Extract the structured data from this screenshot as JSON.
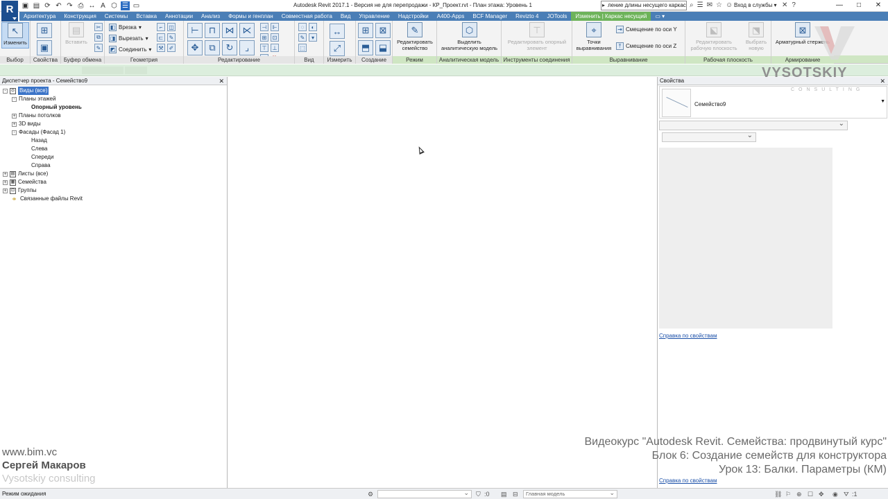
{
  "app": {
    "logo_letter": "R",
    "window_title": "Autodesk Revit 2017.1 - Версия не для перепродажи -   КР_Проект.rvt - План этажа: Уровень 1",
    "search_text": "ление длины несущего каркаса",
    "login_label": "Вход в службы",
    "qat_icons": [
      "open-icon",
      "save-icon",
      "sync-icon",
      "undo-icon",
      "redo-icon",
      "print-icon",
      "measure-icon",
      "text-icon",
      "3d-view-icon",
      "close-windows-icon",
      "switch-windows-icon"
    ],
    "window_controls": [
      "minimize",
      "maximize",
      "close"
    ]
  },
  "tabs": [
    {
      "label": "Архитектура"
    },
    {
      "label": "Конструкция"
    },
    {
      "label": "Системы"
    },
    {
      "label": "Вставка"
    },
    {
      "label": "Аннотации"
    },
    {
      "label": "Анализ"
    },
    {
      "label": "Формы и генплан"
    },
    {
      "label": "Совместная работа"
    },
    {
      "label": "Вид"
    },
    {
      "label": "Управление"
    },
    {
      "label": "Надстройки"
    },
    {
      "label": "A400-Apps"
    },
    {
      "label": "BCF Manager"
    },
    {
      "label": "Revizto 4"
    },
    {
      "label": "JOTools"
    },
    {
      "label": "Изменить | Каркас несущий",
      "active": true
    }
  ],
  "ribbon": {
    "panels": {
      "select": "Выбор",
      "properties": "Свойства",
      "clipboard": "Буфер обмена",
      "geometry": "Геометрия",
      "modify": "Редактирование",
      "view": "Вид",
      "measure": "Измерить",
      "create": "Создание",
      "mode": "Режим",
      "analytical": "Аналитическая модель",
      "connection_tools": "Инструменты соединения",
      "justification": "Выравнивание",
      "work_plane": "Рабочая плоскость",
      "reinforcement": "Армирование"
    },
    "buttons": {
      "modify": "Изменить",
      "paste": "Вставить",
      "cut_geom": "Врезка",
      "cut_out": "Вырезать",
      "join": "Соединить",
      "edit_family": "Редактировать семейство",
      "highlight_analytical": "Выделить аналитическую модель",
      "edit_ref": "Редактировать опорный элемент",
      "justification_points": "Точки выравнивания",
      "y_offset": "Смещение по оси Y",
      "z_offset": "Смещение по оси Z",
      "edit_work_plane": "Редактировать рабочую плоскость",
      "pick_new": "Выбрать новую",
      "rebar": "Арматурный стержень"
    }
  },
  "project_browser": {
    "title": "Диспетчер проекта - Семейство9",
    "tree": [
      {
        "label": "Виды (все)",
        "level": 0,
        "expander": "-",
        "selected": true,
        "icon": "views-icon"
      },
      {
        "label": "Планы этажей",
        "level": 1,
        "expander": "-"
      },
      {
        "label": "Опорный уровень",
        "level": 2,
        "bold": true
      },
      {
        "label": "Планы потолков",
        "level": 1,
        "expander": "+"
      },
      {
        "label": "3D виды",
        "level": 1,
        "expander": "+"
      },
      {
        "label": "Фасады (Фасад 1)",
        "level": 1,
        "expander": "-"
      },
      {
        "label": "Назад",
        "level": 2
      },
      {
        "label": "Слева",
        "level": 2
      },
      {
        "label": "Спереди",
        "level": 2
      },
      {
        "label": "Справа",
        "level": 2
      },
      {
        "label": "Листы (все)",
        "level": 0,
        "expander": "+",
        "icon": "sheets-icon"
      },
      {
        "label": "Семейства",
        "level": 0,
        "expander": "+",
        "icon": "families-icon"
      },
      {
        "label": "Группы",
        "level": 0,
        "expander": "+",
        "icon": "groups-icon"
      },
      {
        "label": "Связанные файлы Revit",
        "level": 0,
        "icon": "revit-links-icon"
      }
    ]
  },
  "watermark": {
    "url": "www.bim.vc",
    "author": "Сергей Макаров",
    "company": "Vysotskiy consulting"
  },
  "properties": {
    "title": "Свойства",
    "type_name": "Семейство9",
    "help_link": "Справка по свойствам",
    "logo_main": "VYSOTSKIY",
    "logo_sub": "CONSULTING"
  },
  "course": {
    "line1": "Видеокурс \"Autodesk Revit. Семейства: продвинутый курс\"",
    "line2": "Блок 6: Создание семейств для конструктора",
    "line3": "Урок 13: Балки. Параметры (КМ)"
  },
  "status": {
    "text": "Режим ожидания",
    "coord_readout": ":0",
    "model_selector": "Главная модель",
    "filter_count": ":1"
  }
}
